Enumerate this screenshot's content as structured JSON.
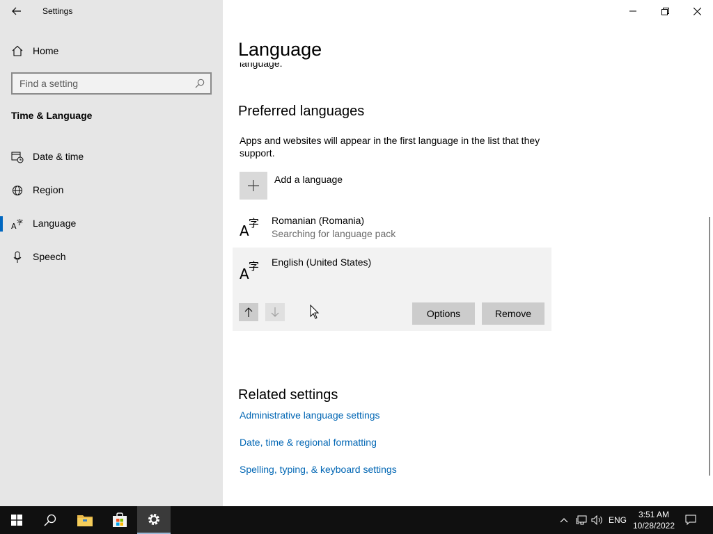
{
  "window": {
    "title": "Settings"
  },
  "sidebar": {
    "home_label": "Home",
    "search_placeholder": "Find a setting",
    "section_title": "Time & Language",
    "items": [
      {
        "label": "Date & time",
        "icon": "calendar-clock-icon",
        "selected": false
      },
      {
        "label": "Region",
        "icon": "globe-icon",
        "selected": false
      },
      {
        "label": "Language",
        "icon": "language-icon",
        "selected": true
      },
      {
        "label": "Speech",
        "icon": "microphone-icon",
        "selected": false
      }
    ]
  },
  "main": {
    "page_title": "Language",
    "clipped_text": "language.",
    "preferred": {
      "heading": "Preferred languages",
      "description": "Apps and websites will appear in the first language in the list that they support.",
      "add_label": "Add a language",
      "languages": [
        {
          "name": "Romanian (Romania)",
          "status": "Searching for language pack"
        },
        {
          "name": "English (United States)",
          "status": ""
        }
      ],
      "options_label": "Options",
      "remove_label": "Remove"
    },
    "related": {
      "heading": "Related settings",
      "links": [
        "Administrative language settings",
        "Date, time & regional formatting",
        "Spelling, typing, & keyboard settings"
      ]
    }
  },
  "taskbar": {
    "language_indicator": "ENG",
    "time": "3:51 AM",
    "date": "10/28/2022"
  },
  "colors": {
    "accent": "#0067c0",
    "link": "#0066b4",
    "sidebar_bg": "#e6e6e6",
    "taskbar_bg": "#101010"
  }
}
